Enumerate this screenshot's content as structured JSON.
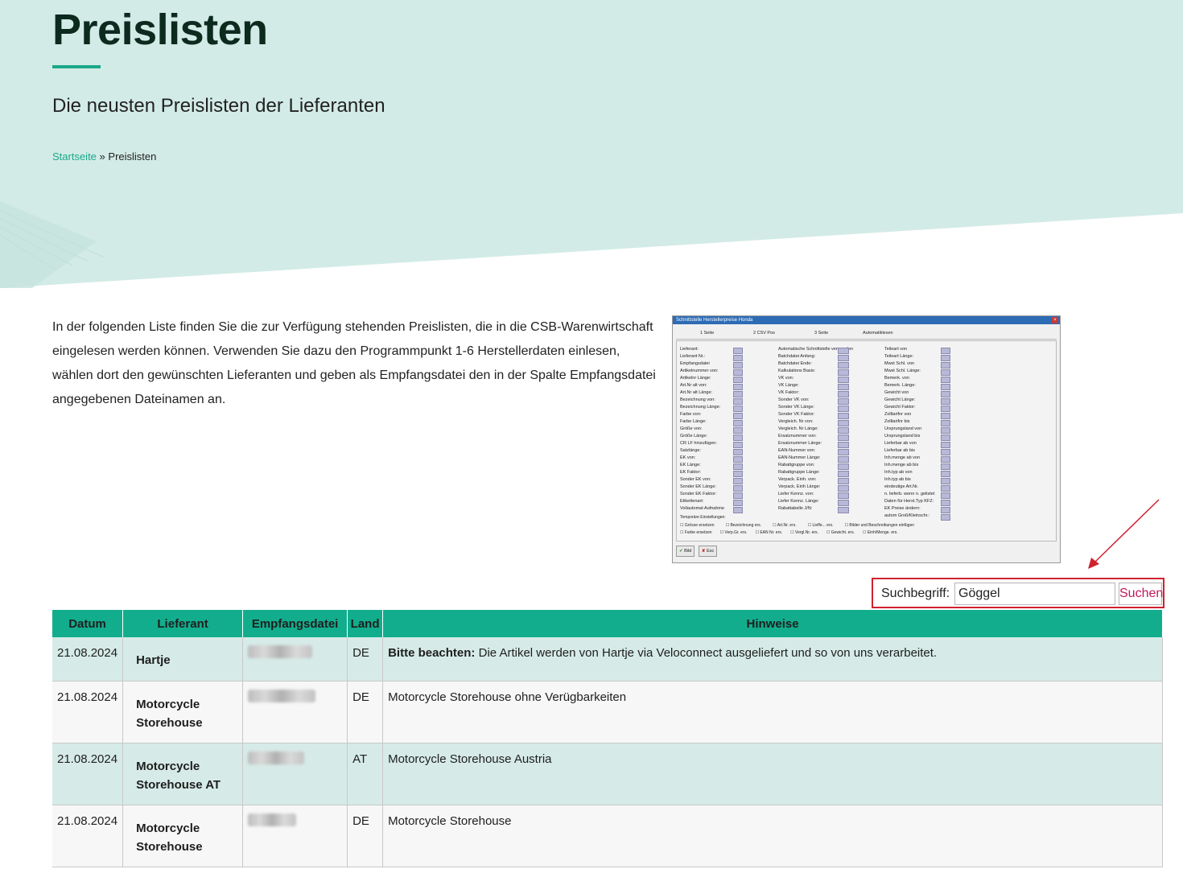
{
  "header": {
    "title": "Preislisten",
    "subtitle": "Die neusten Preislisten der Lieferanten"
  },
  "breadcrumb": {
    "home": "Startseite",
    "separator": "»",
    "current": "Preislisten"
  },
  "intro": "In der folgenden Liste finden Sie die zur Verfügung stehenden Preislisten, die in die CSB-Warenwirtschaft eingelesen werden können. Verwenden Sie dazu den Programmpunkt 1-6 Herstellerdaten einlesen, wählen dort den gewünschten Lieferanten und geben als Empfangsdatei den in der Spalte Empfangsdatei angegebenen Dateinamen an.",
  "screenshot": {
    "window_title": "Schnittstelle Herstellerpreise Honda",
    "tabs": [
      "1 Seite",
      "2 CSV Pos",
      "3 Seite",
      "Automatiklesen"
    ],
    "col1": [
      "Lieferant:",
      "Lieferant Nr.:",
      "Empfangsdatei",
      "Artikelnummer von:",
      "Artikelnr Länge:",
      "Art.Nr alt von:",
      "Art.Nr alt Länge:",
      "Bezeichnung von:",
      "Bezeichnung Länge:",
      "Farbe von:",
      "Farbe Länge:",
      "Größe von:",
      "Größe Länge:",
      "CR LF hinzufügen:",
      "Satzlänge:",
      "EK von:",
      "EK Länge:",
      "EK Faktor:",
      "Sonder EK von:",
      "Sonder EK Länge:",
      "Sonder EK Faktor:",
      "Etikettenart:",
      "Vollautomat Aufnahme"
    ],
    "col2": [
      "Automatische Schnittstelle verwenden",
      "Batchdatei Anfang:",
      "Batchdatei Ende:",
      "Kalkulations Basis:",
      "VK von:",
      "VK Länge:",
      "VK Faktor:",
      "Sonder VK von:",
      "Sonder VK Länge:",
      "Sonder VK Faktor:",
      "Vergleich. Nr von:",
      "Vergleich. Nr Länge:",
      "Ersatznummer von:",
      "Ersatznummer Länge:",
      "EAN-Nummer von:",
      "EAN-Nummer Länge:",
      "Rabattgruppe von:",
      "Rabattgruppe Länge:",
      "Verpack. Einh. von:",
      "Verpack. Einh Länge:",
      "Liefer Kennz. von:",
      "Liefer Kennz. Länge:",
      "Rabattabelle J/N:"
    ],
    "col3": [
      "Teileart von",
      "Teileart Länge:",
      "Mwst Schl. von",
      "Mwst Schl. Länge:",
      "Bemerk. von",
      "Bemerk. Länge:",
      "Gewicht von",
      "Gewicht Länge:",
      "Gewicht Faktor:",
      "Zolltarifnr von",
      "Zolltarifnr bis",
      "Ursprungsland von",
      "Ursprungsland bis",
      "Lieferbar ab von",
      "Lieferbar ab bis",
      "Inh.menge ab von",
      "Inh.menge ab bis",
      "Inh.typ ab von",
      "Inh.typ ab bis",
      "eindeutige Art.Nr.",
      "n. lieferb. wenn n. gelistet",
      "Daten für Herst.Typ KFZ:",
      "EK Preise ändern:",
      "autom Groß/Kleinschr.:"
    ],
    "temp_label": "Temporäre Einstellungen:",
    "checks_row1": [
      "Grösse ersetzen",
      "Bezeichnung ers.",
      "Art.Nr. ers.",
      "Lieffe... ers.",
      "Bilder und Beschreibungen einfügen"
    ],
    "checks_row2": [
      "Farbe ersetzen",
      "Verp.Gr. ers.",
      "EAN Nr. ers.",
      "Vergl.Nr. ers.",
      "Gewicht. ers.",
      "Einh/Menge. ers."
    ],
    "btn_ok": "Bild",
    "btn_esc": "Esc"
  },
  "search": {
    "label": "Suchbegriff:",
    "value": "Göggel",
    "button": "Suchen"
  },
  "table": {
    "headers": [
      "Datum",
      "Lieferant",
      "Empfangsdatei",
      "Land",
      "Hinweise"
    ],
    "rows": [
      {
        "date": "21.08.2024",
        "supplier": "Hartje",
        "country": "DE",
        "note_bold": "Bitte beachten:",
        "note": " Die Artikel werden von Hartje via Veloconnect ausgeliefert und so von uns verarbeitet."
      },
      {
        "date": "21.08.2024",
        "supplier": "Motorcycle Storehouse",
        "country": "DE",
        "note_bold": "",
        "note": "Motorcycle Storehouse ohne Verügbarkeiten"
      },
      {
        "date": "21.08.2024",
        "supplier": "Motorcycle Storehouse AT",
        "country": "AT",
        "note_bold": "",
        "note": "Motorcycle Storehouse Austria"
      },
      {
        "date": "21.08.2024",
        "supplier": "Motorcycle Storehouse",
        "country": "DE",
        "note_bold": "",
        "note": "Motorcycle Storehouse"
      }
    ]
  },
  "colors": {
    "accent": "#1ba88a",
    "table_header": "#12ad8d",
    "hero_bg": "#d3ebe6",
    "highlight_border": "#d0212f",
    "button_text": "#c2185b"
  }
}
